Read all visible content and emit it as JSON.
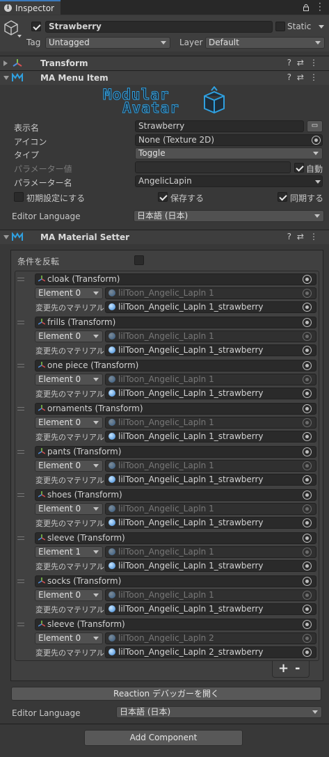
{
  "window": {
    "tab_title": "Inspector",
    "tab_icon": "info-icon",
    "lock_icon": "lock-icon",
    "menu_icon": "kebab-icon"
  },
  "gameobject": {
    "active": true,
    "name": "Strawberry",
    "static_label": "Static",
    "static_checked": false,
    "tag_label": "Tag",
    "tag_value": "Untagged",
    "layer_label": "Layer",
    "layer_value": "Default"
  },
  "components": {
    "transform": {
      "title": "Transform",
      "expanded": false
    },
    "menu_item": {
      "title": "MA Menu Item",
      "expanded": true,
      "logo_line1": "Modular",
      "logo_line2": "Avatar",
      "name_label": "表示名",
      "name_value": "Strawberry",
      "icon_label": "アイコン",
      "icon_value": "None (Texture 2D)",
      "type_label": "タイプ",
      "type_value": "Toggle",
      "param_value_label": "パラメーター値",
      "param_value": "",
      "auto_label": "自動",
      "auto_checked": true,
      "param_name_label": "パラメーター名",
      "param_name_value": "AngelicLapin",
      "default_label": "初期設定にする",
      "default_checked": false,
      "saved_label": "保存する",
      "saved_checked": true,
      "synced_label": "同期する",
      "synced_checked": true,
      "editor_language_label": "Editor Language",
      "editor_language_value": "日本語 (日本)"
    },
    "material_setter": {
      "title": "MA Material Setter",
      "expanded": true,
      "invert_label": "条件を反転",
      "invert_checked": false,
      "target_label": "変更先のマテリアル",
      "entries": [
        {
          "object": "cloak (Transform)",
          "element": "Element 0",
          "source": "lilToon_Angelic_Lapln 1",
          "target": "lilToon_Angelic_Lapln 1_strawberry"
        },
        {
          "object": "frills (Transform)",
          "element": "Element 0",
          "source": "lilToon_Angelic_Lapln 1",
          "target": "lilToon_Angelic_Lapln 1_strawberry"
        },
        {
          "object": "one piece (Transform)",
          "element": "Element 0",
          "source": "lilToon_Angelic_Lapln 1",
          "target": "lilToon_Angelic_Lapln 1_strawberry"
        },
        {
          "object": "ornaments (Transform)",
          "element": "Element 0",
          "source": "lilToon_Angelic_Lapln 1",
          "target": "lilToon_Angelic_Lapln 1_strawberry"
        },
        {
          "object": "pants (Transform)",
          "element": "Element 0",
          "source": "lilToon_Angelic_Lapln 1",
          "target": "lilToon_Angelic_Lapln 1_strawberry"
        },
        {
          "object": "shoes (Transform)",
          "element": "Element 0",
          "source": "lilToon_Angelic_Lapln 1",
          "target": "lilToon_Angelic_Lapln 1_strawberry"
        },
        {
          "object": "sleeve (Transform)",
          "element": "Element 1",
          "source": "lilToon_Angelic_Lapln 1",
          "target": "lilToon_Angelic_Lapln 1_strawberry"
        },
        {
          "object": "socks (Transform)",
          "element": "Element 0",
          "source": "lilToon_Angelic_Lapln 1",
          "target": "lilToon_Angelic_Lapln 1_strawberry"
        },
        {
          "object": "sleeve (Transform)",
          "element": "Element 0",
          "source": "lilToon_Angelic_Lapln 2",
          "target": "lilToon_Angelic_Lapln 2_strawberry"
        }
      ],
      "add_label": "+",
      "remove_label": "-",
      "debugger_button": "Reaction デバッガーを開く",
      "editor_language_label": "Editor Language",
      "editor_language_value": "日本語 (日本)"
    }
  },
  "add_component_button": "Add Component",
  "colors": {
    "accent": "#3a79bb",
    "ma_icon": "#2fa0e0"
  }
}
